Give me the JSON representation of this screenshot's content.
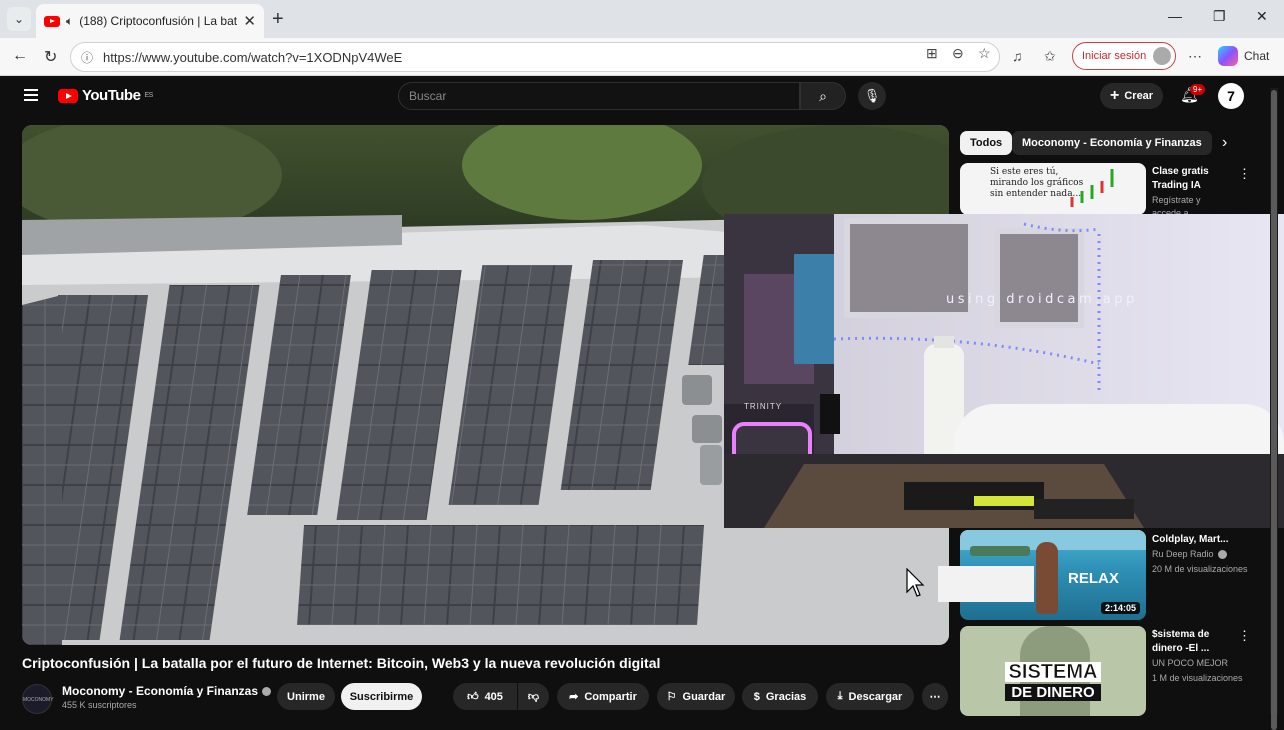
{
  "browser": {
    "tab_title": "(188) Criptoconfusión | La bat",
    "url": "https://www.youtube.com/watch?v=1XODNpV4WeE",
    "signin_label": "Iniciar sesión",
    "chat_label": "Chat"
  },
  "header": {
    "logo_text": "YouTube",
    "logo_region": "ES",
    "search_placeholder": "Buscar",
    "create_label": "Crear",
    "notif_badge": "9+"
  },
  "video": {
    "title": "Criptoconfusión | La batalla por el futuro de Internet: Bitcoin, Web3 y la nueva revolución digital",
    "channel_name": "Moconomy - Economía y Finanzas",
    "channel_avatar_text": "MOCONOMY",
    "subscribers": "455 K suscriptores",
    "join_label": "Unirme",
    "subscribe_label": "Suscribirme",
    "likes": "405",
    "share_label": "Compartir",
    "save_label": "Guardar",
    "thanks_label": "Gracias",
    "download_label": "Descargar"
  },
  "sidebar": {
    "chips": [
      "Todos",
      "Moconomy - Economía y Finanzas"
    ],
    "items": [
      {
        "title_lines": [
          "Clase gratis",
          "Trading IA"
        ],
        "meta_lines": [
          "Regístrate y",
          "accede a"
        ],
        "thumb_text": [
          "Si este eres tú,",
          "mirando los gráficos",
          "sin entender nada..."
        ]
      },
      {
        "title_lines": [
          "Coldplay, Mart..."
        ],
        "channel": "Ru Deep Radio",
        "views": "20 M de visualizaciones",
        "thumb_text": "RELAX",
        "duration": "2:14:05"
      },
      {
        "title_lines": [
          "$sistema de",
          "dinero -El ..."
        ],
        "channel": "UN POCO MEJOR",
        "views": "1 M de visualizaciones",
        "thumb_text": [
          "SISTEMA",
          "DE DINERO"
        ]
      }
    ]
  },
  "overlay": {
    "watermark": "using droidcam.app",
    "bottle_label": "TRINITY"
  },
  "colors": {
    "yt_red": "#ff0000",
    "bg": "#0f0f0f",
    "chip_bg": "#272727",
    "led_blue": "#6f7dff"
  }
}
